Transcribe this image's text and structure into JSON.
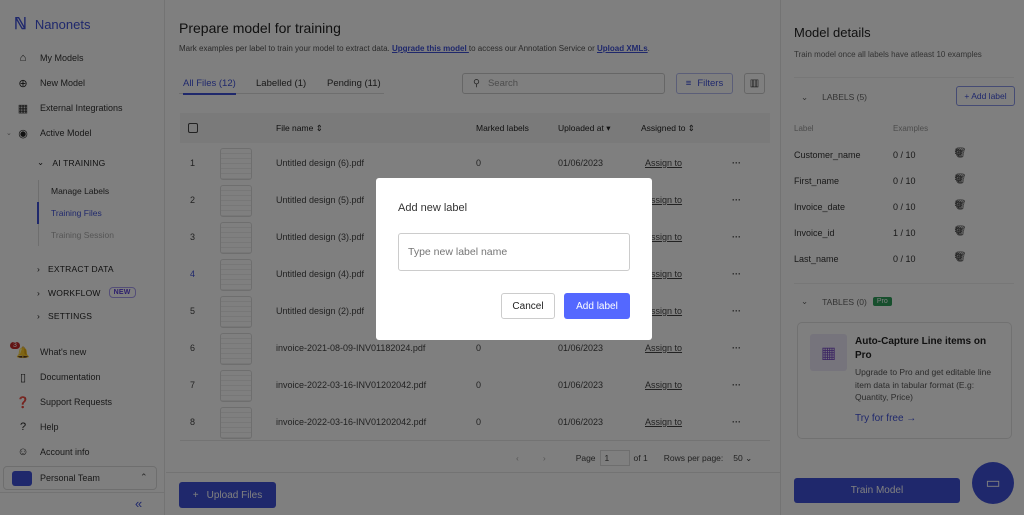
{
  "app": {
    "name": "Nanonets"
  },
  "sidebar": {
    "items": [
      {
        "label": "My Models",
        "icon": "home-icon"
      },
      {
        "label": "New Model",
        "icon": "plus-circle-icon"
      },
      {
        "label": "External Integrations",
        "icon": "integrations-icon"
      },
      {
        "label": "Active Model",
        "icon": "compass-icon"
      }
    ],
    "ai_training": "AI TRAINING",
    "sub": [
      "Manage Labels",
      "Training Files",
      "Training Session"
    ],
    "extract": "EXTRACT DATA",
    "workflow": "WORKFLOW",
    "new_badge": "NEW",
    "settings": "SETTINGS",
    "bottom": [
      {
        "label": "What's new",
        "icon": "bell-icon"
      },
      {
        "label": "Documentation",
        "icon": "book-icon"
      },
      {
        "label": "Support Requests",
        "icon": "question-bubble-icon"
      },
      {
        "label": "Help",
        "icon": "help-circle-icon"
      },
      {
        "label": "Account info",
        "icon": "account-icon"
      }
    ],
    "notif_count": "3",
    "team": "Personal Team"
  },
  "main": {
    "title": "Prepare model for training",
    "desc_pre": "Mark examples per label to train your model to extract data. ",
    "upgrade_link": "Upgrade this model ",
    "desc_mid": "to access our Annotation Service or ",
    "xml_link": "Upload XMLs",
    "desc_end": ".",
    "tabs": [
      "All Files (12)",
      "Labelled (1)",
      "Pending (11)"
    ],
    "search_placeholder": "Search",
    "filters": "Filters",
    "columns": [
      "File name",
      "Marked labels",
      "Uploaded at",
      "Assigned to"
    ],
    "rows": [
      {
        "n": "1",
        "file": "Untitled design (6).pdf",
        "marked": "0",
        "date": "01/06/2023",
        "assign": "Assign to"
      },
      {
        "n": "2",
        "file": "Untitled design (5).pdf",
        "marked": "0",
        "date": "01/06/2023",
        "assign": "Assign to"
      },
      {
        "n": "3",
        "file": "Untitled design (3).pdf",
        "marked": "0",
        "date": "01/06/2023",
        "assign": "Assign to"
      },
      {
        "n": "4",
        "file": "Untitled design (4).pdf",
        "marked": "0",
        "date": "01/06/2023",
        "assign": "Assign to"
      },
      {
        "n": "5",
        "file": "Untitled design (2).pdf",
        "marked": "0",
        "date": "01/06/2023",
        "assign": "Assign to"
      },
      {
        "n": "6",
        "file": "invoice-2021-08-09-INV01182024.pdf",
        "marked": "0",
        "date": "01/06/2023",
        "assign": "Assign to"
      },
      {
        "n": "7",
        "file": "invoice-2022-03-16-INV01202042.pdf",
        "marked": "0",
        "date": "01/06/2023",
        "assign": "Assign to"
      },
      {
        "n": "8",
        "file": "invoice-2022-03-16-INV01202042.pdf",
        "marked": "0",
        "date": "01/06/2023",
        "assign": "Assign to"
      }
    ],
    "pagination": {
      "page_label": "Page",
      "page": "1",
      "of": "of 1",
      "rows_label": "Rows per page:",
      "rows": "50"
    },
    "upload": "Upload Files"
  },
  "right": {
    "title": "Model details",
    "subtitle": "Train model once all labels have atleast 10 examples",
    "labels_header": "LABELS (5)",
    "add_label": "+ Add label",
    "col_label": "Label",
    "col_examples": "Examples",
    "labels": [
      {
        "name": "Customer_name",
        "ex": "0 / 10"
      },
      {
        "name": "First_name",
        "ex": "0 / 10"
      },
      {
        "name": "Invoice_date",
        "ex": "0 / 10"
      },
      {
        "name": "Invoice_id",
        "ex": "1 / 10"
      },
      {
        "name": "Last_name",
        "ex": "0 / 10"
      }
    ],
    "tables_header": "TABLES (0)",
    "pro": "Pro",
    "promo_title": "Auto-Capture Line items on Pro",
    "promo_text": "Upgrade to Pro and get editable line item data in tabular format (E.g: Quantity, Price)",
    "try": "Try for free →",
    "train": "Train Model"
  },
  "modal": {
    "title": "Add new label",
    "placeholder": "Type new label name",
    "cancel": "Cancel",
    "add": "Add label"
  },
  "colors": {
    "accent": "#3f51d9",
    "button": "#5468ff",
    "pro": "#2e9e5b"
  }
}
